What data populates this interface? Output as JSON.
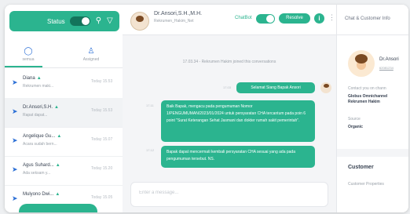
{
  "toolbar": {
    "status_label": "Status"
  },
  "tabs": [
    {
      "label": "semua"
    },
    {
      "label": "Assigned"
    }
  ],
  "conversations": [
    {
      "name": "Diana",
      "preview": "Rekrumen maki...",
      "time": "Today 15.53"
    },
    {
      "name": "Dr.Ansori,S.H.",
      "preview": "Rapat dapat...",
      "time": "Today 15.53"
    },
    {
      "name": "Angelique Gu...",
      "preview": "Acara sudah bern...",
      "time": "Today 15.07"
    },
    {
      "name": "Agus Suhard...",
      "preview": "Ada seksam y...",
      "time": "Today 15.20"
    },
    {
      "name": "Mulyono Dwi...",
      "preview": "",
      "time": "Today 15.05"
    }
  ],
  "header": {
    "name": "Dr.Ansori,S.H.,M.H.",
    "subtitle": "Rekrumen_Hakim_Net",
    "chatbot_label": "ChatBot",
    "resolve_label": "Resolve"
  },
  "messages": {
    "system": "17.03.34 - Rekrumen Hakim joined this conversations",
    "outgoing": {
      "text": "Selamat Siang Bapak Ansori",
      "time": "17.03"
    },
    "incoming": [
      {
        "time": "17.11",
        "text": "Baik Bapak, mengacu pada pengumuman Nomor 1/PENGUMUMAN/2023/01/2024 untuk persyaratan CHA tercantum pada poin 6 point \"Surat Keterangan Sehat Jasmani dan dokter rumah sakit pemerintah\"."
      },
      {
        "time": "17.12",
        "text": "Bapak dapat mencermati kembali persyaratan CHA sesuai yang ada pada pengumuman tersebut. NS."
      }
    ]
  },
  "composer": {
    "placeholder": "Enter a message..."
  },
  "right_panel": {
    "title": "Chat & Customer Info",
    "name": "Dr.Ansori",
    "id": "62081234",
    "contact_label": "Contact you on chann",
    "contact_value": "Globus Omnichannel Rekrumen Hakim",
    "source_label": "Source",
    "source_value": "Organic",
    "customer_heading": "Customer",
    "customer_property": "Customer Properties"
  },
  "colors": {
    "accent": "#2bb48f",
    "link": "#2b6fd6"
  }
}
